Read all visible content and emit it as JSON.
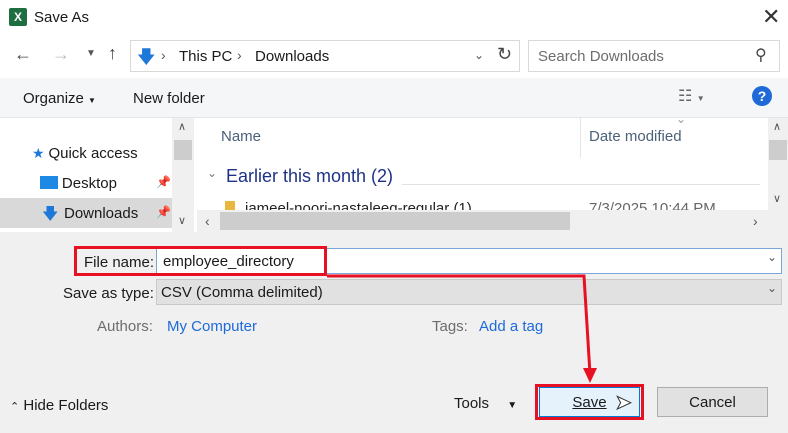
{
  "window": {
    "title": "Save As"
  },
  "nav": {
    "path": [
      "This PC",
      "Downloads"
    ],
    "search_placeholder": "Search Downloads"
  },
  "toolbar": {
    "organize": "Organize",
    "new_folder": "New folder",
    "help": "?"
  },
  "sidebar": {
    "items": [
      {
        "label": "Quick access"
      },
      {
        "label": "Desktop"
      },
      {
        "label": "Downloads"
      }
    ]
  },
  "list": {
    "columns": [
      "Name",
      "Date modified"
    ],
    "group": "Earlier this month (2)",
    "files": [
      {
        "name": "jameel-noori-nastaleeq-regular (1)",
        "date": "7/3/2025 10:44 PM"
      }
    ]
  },
  "form": {
    "file_name_label": "File name:",
    "file_name": "employee_directory",
    "type_label": "Save as type:",
    "type_value": "CSV (Comma delimited)",
    "authors_label": "Authors:",
    "authors_value": "My Computer",
    "tags_label": "Tags:",
    "tags_value": "Add a tag"
  },
  "footer": {
    "hide_folders": "Hide Folders",
    "tools": "Tools",
    "save": "Save",
    "cancel": "Cancel"
  },
  "colors": {
    "highlight": "#e81123",
    "accent": "#1e6ad9"
  }
}
